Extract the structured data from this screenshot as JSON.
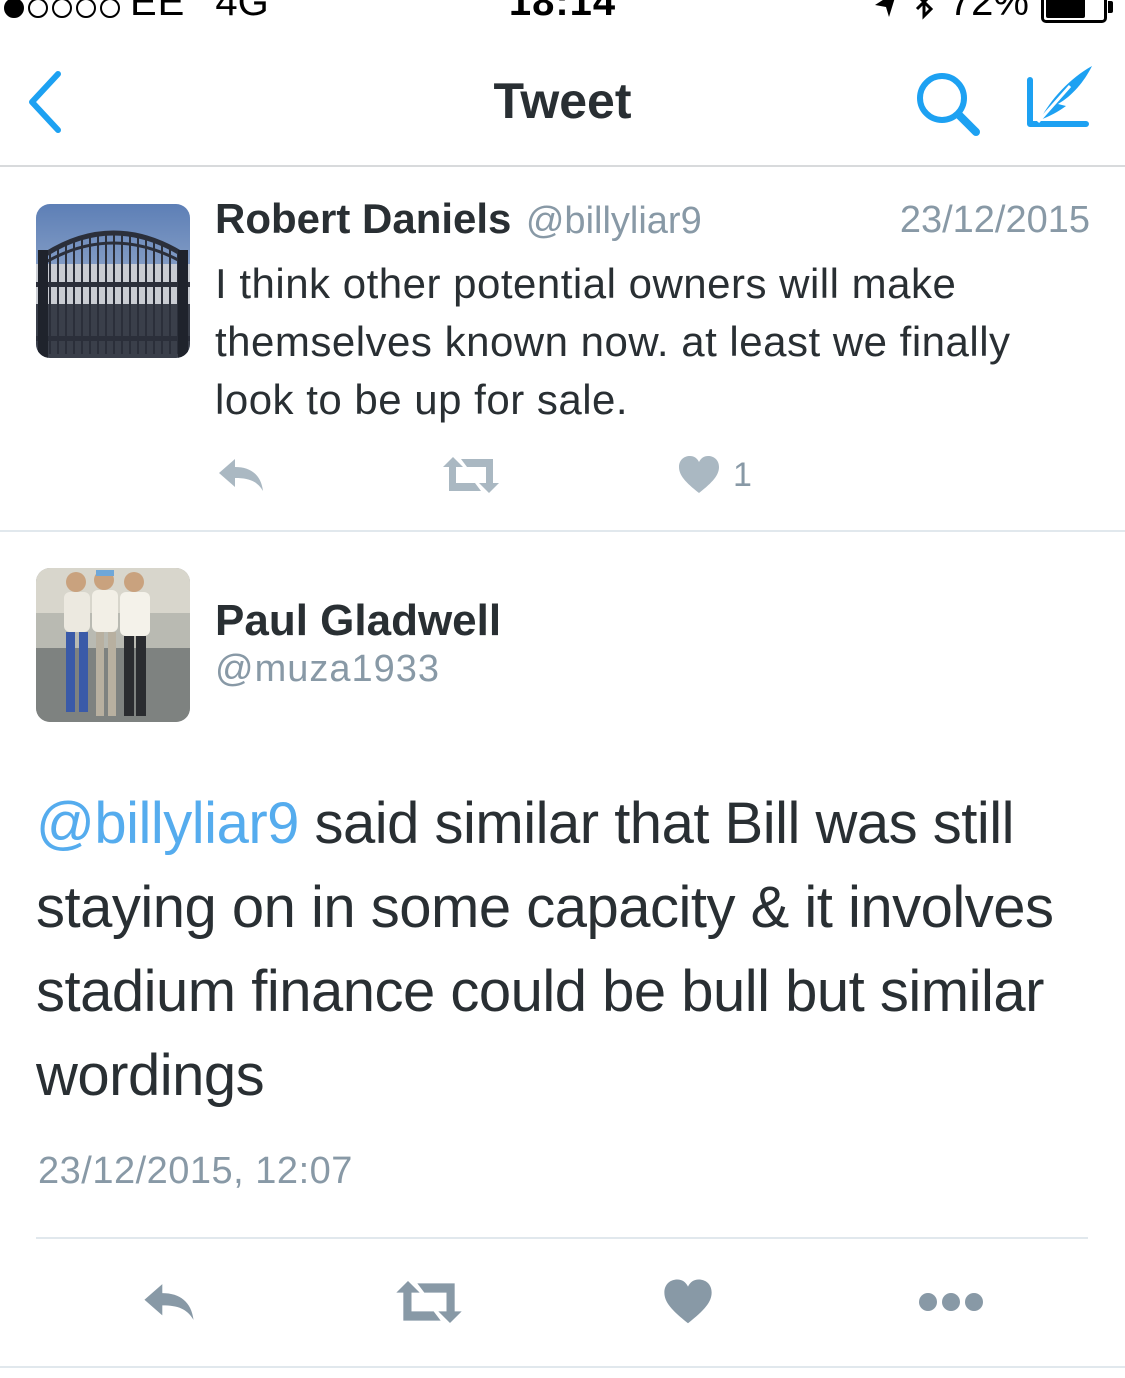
{
  "status_bar": {
    "carrier": "EE",
    "network": "4G",
    "time": "18:14",
    "battery_text": "72%",
    "battery_level": 0.72,
    "signal_bars": 1,
    "signal_total": 5
  },
  "nav": {
    "title": "Tweet",
    "back_icon": "chevron-left-icon",
    "search_icon": "search-icon",
    "compose_icon": "compose-tweet-icon",
    "accent_color": "#1da1f2"
  },
  "parent_tweet": {
    "name": "Robert Daniels",
    "handle": "@billyliar9",
    "date": "23/12/2015",
    "text": "I think other potential owners will make themselves known now. at least we finally look to be up for sale.",
    "like_count": "1"
  },
  "tweet": {
    "name": "Paul Gladwell",
    "handle": "@muza1933",
    "mention": "@billyliar9",
    "text": " said similar that Bill was still staying on in some capacity & it involves stadium finance could be bull but similar wordings",
    "timestamp": "23/12/2015, 12:07"
  },
  "colors": {
    "text": "#292f33",
    "secondary": "#8899a6",
    "link": "#55acee",
    "divider": "#e1e8ed"
  }
}
